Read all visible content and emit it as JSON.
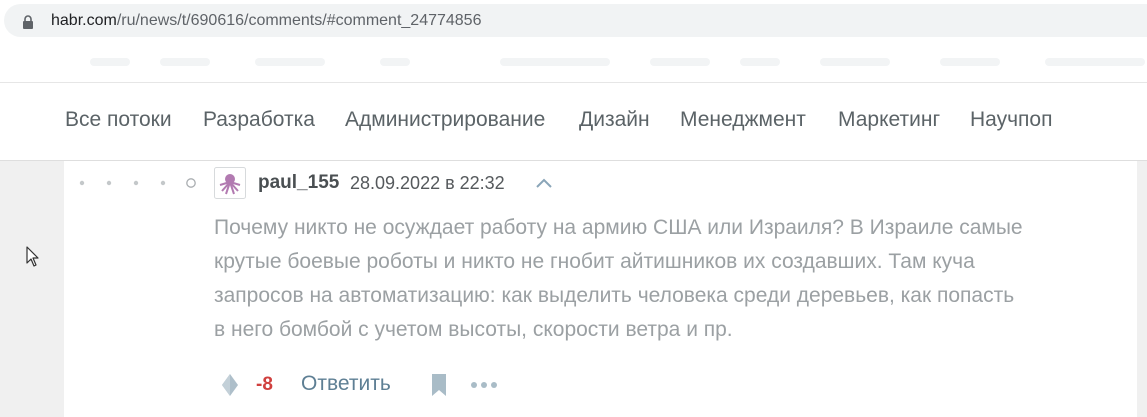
{
  "browser": {
    "url_host": "habr.com",
    "url_path": "/ru/news/t/690616/comments/#comment_24774856"
  },
  "nav": {
    "items": [
      {
        "label": "Все потоки"
      },
      {
        "label": "Разработка"
      },
      {
        "label": "Администрирование"
      },
      {
        "label": "Дизайн"
      },
      {
        "label": "Менеджмент"
      },
      {
        "label": "Маркетинг"
      },
      {
        "label": "Научпоп"
      }
    ]
  },
  "comment": {
    "author": "paul_155",
    "timestamp": "28.09.2022 в 22:32",
    "lines": [
      "Почему никто не осуждает работу на армию США или Израиля? В Израиле самые",
      "крутые боевые роботы и никто не гнобит айтишников их создавших. Там куча",
      "запросов на автоматизацию: как выделить человека среди деревьев, как попасть",
      "в него бомбой с учетом высоты, скорости ветра и пр."
    ],
    "score": "-8",
    "reply_label": "Ответить"
  },
  "icons": {
    "lock": "lock-icon",
    "vote": "vote-icon",
    "bookmark": "bookmark-icon",
    "more": "more-icon",
    "parent_arrow": "chevron-up-icon"
  },
  "colors": {
    "score_negative": "#d0403e",
    "reply_link": "#5e7f94",
    "body_text": "#9ba0a3"
  }
}
